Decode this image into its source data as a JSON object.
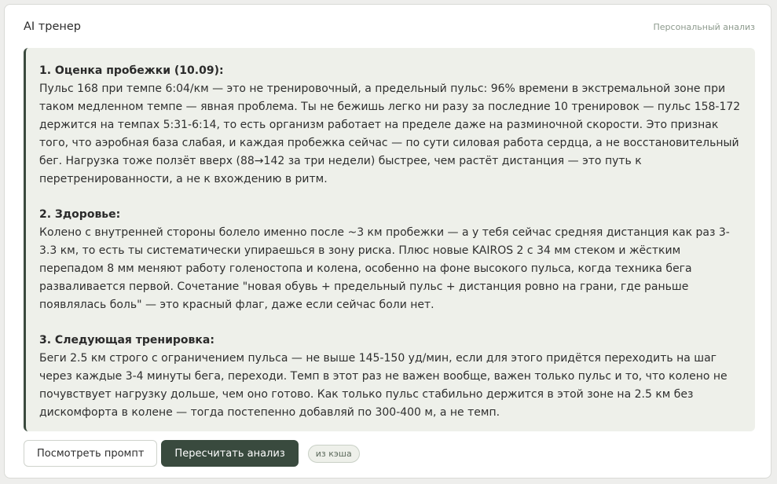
{
  "header": {
    "title": "AI тренер",
    "subtitle": "Персональный анализ"
  },
  "analysis": {
    "sections": [
      {
        "heading": "1. Оценка пробежки (10.09):",
        "body": "Пульс 168 при темпе 6:04/км — это не тренировочный, а предельный пульс: 96% времени в экстремальной зоне при таком медленном темпе — явная проблема. Ты не бежишь легко ни разу за последние 10 тренировок — пульс 158-172 держится на темпах 5:31-6:14, то есть организм работает на пределе даже на разминочной скорости. Это признак того, что аэробная база слабая, и каждая пробежка сейчас — по сути силовая работа сердца, а не восстановительный бег. Нагрузка тоже ползёт вверх (88→142 за три недели) быстрее, чем растёт дистанция — это путь к перетренированности, а не к вхождению в ритм."
      },
      {
        "heading": "2. Здоровье:",
        "body": "Колено с внутренней стороны болело именно после ~3 км пробежки — а у тебя сейчас средняя дистанция как раз 3-3.3 км, то есть ты систематически упираешься в зону риска. Плюс новые KAIROS 2 с 34 мм стеком и жёстким перепадом 8 мм меняют работу голеностопа и колена, особенно на фоне высокого пульса, когда техника бега разваливается первой. Сочетание \"новая обувь + предельный пульс + дистанция ровно на грани, где раньше появлялась боль\" — это красный флаг, даже если сейчас боли нет."
      },
      {
        "heading": "3. Следующая тренировка:",
        "body": "Беги 2.5 км строго с ограничением пульса — не выше 145-150 уд/мин, если для этого придётся переходить на шаг через каждые 3-4 минуты бега, переходи. Темп в этот раз не важен вообще, важен только пульс и то, что колено не почувствует нагрузку дольше, чем оно готово. Как только пульс стабильно держится в этой зоне на 2.5 км без дискомфорта в колене — тогда постепенно добавляй по 300-400 м, а не темп."
      }
    ]
  },
  "actions": {
    "view_prompt_label": "Посмотреть промпт",
    "recalculate_label": "Пересчитать анализ",
    "cache_badge": "из кэша"
  },
  "colors": {
    "accent": "#394a3e",
    "panel_bg": "#eef0ea",
    "subtitle": "#8d9a8d"
  }
}
